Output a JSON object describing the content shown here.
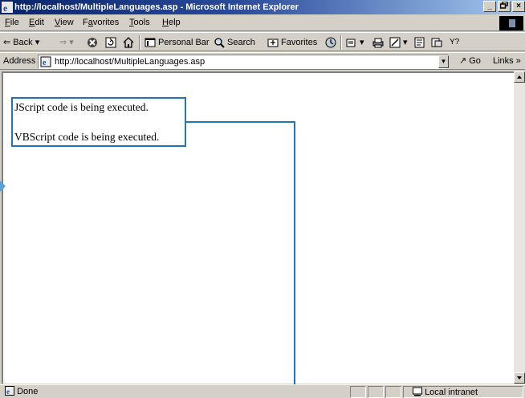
{
  "window": {
    "title": "http://localhost/MultipleLanguages.asp - Microsoft Internet Explorer",
    "minimize": "_",
    "maximize": "б",
    "close": "×"
  },
  "menu": [
    {
      "label": "File",
      "key": "F"
    },
    {
      "label": "Edit",
      "key": "E"
    },
    {
      "label": "View",
      "key": "V"
    },
    {
      "label": "Favorites",
      "key": "a"
    },
    {
      "label": "Tools",
      "key": "T"
    },
    {
      "label": "Help",
      "key": "H"
    }
  ],
  "toolbar": {
    "back": "Back",
    "personal_bar": "Personal Bar",
    "search": "Search",
    "favorites": "Favorites"
  },
  "address": {
    "label": "Address",
    "url": "http://localhost/MultipleLanguages.asp",
    "go": "Go",
    "links": "Links"
  },
  "content": {
    "lines": [
      "JScript code is being executed.",
      "VBScript code is being executed."
    ]
  },
  "status": {
    "text": "Done",
    "zone": "Local intranet"
  },
  "colors": {
    "titlebar_start": "#0a246a",
    "titlebar_end": "#a6caf0",
    "callout": "#2076b8",
    "chrome": "#d4d0c8"
  }
}
